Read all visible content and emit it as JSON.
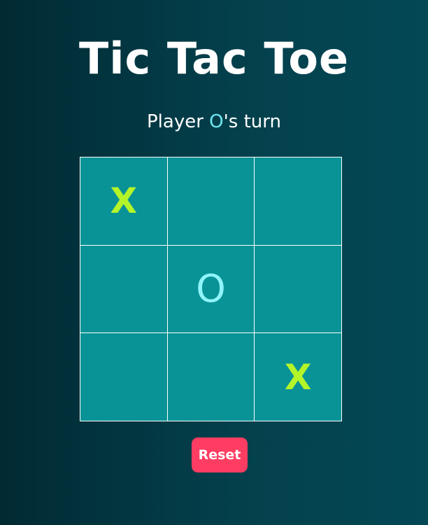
{
  "title": "Tic Tac Toe",
  "status": {
    "prefix": "Player ",
    "player": "O",
    "suffix": "'s turn"
  },
  "board": {
    "cells": [
      "X",
      "",
      "",
      "",
      "O",
      "",
      "",
      "",
      "X"
    ]
  },
  "colors": {
    "x_mark": "#b4f52a",
    "o_mark": "#8ff4fb",
    "cell_bg": "#0a9396",
    "reset_bg": "#ff3d63"
  },
  "reset_label": "Reset"
}
